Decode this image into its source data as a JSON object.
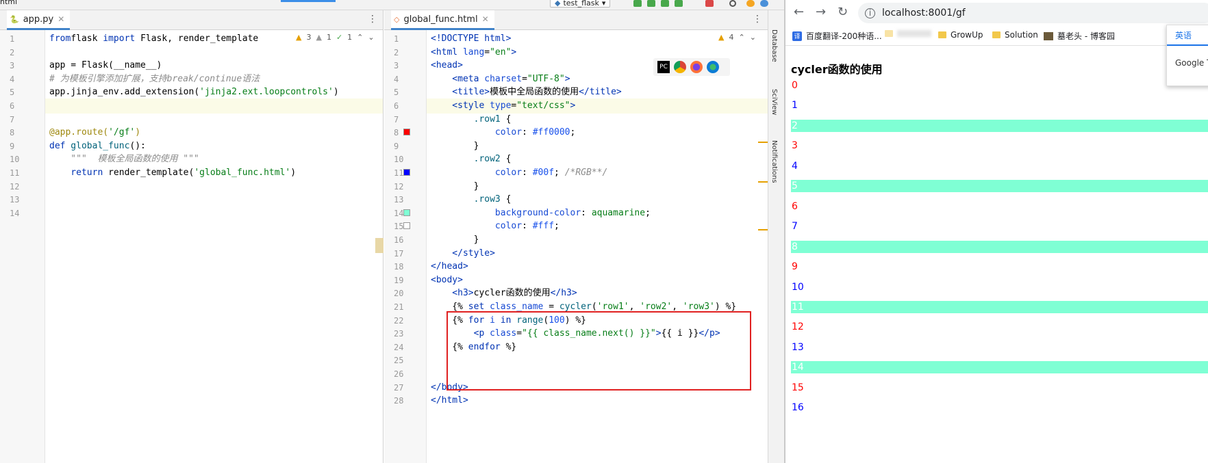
{
  "toolbar": {
    "crumb": "html",
    "run_config": "test_flask"
  },
  "left_editor": {
    "tab_label": "app.py",
    "inspection": {
      "warnings": "3",
      "weak_warnings": "1",
      "ok": "1"
    },
    "lines": [
      {
        "n": "1",
        "tokens": [
          [
            "kw",
            "from"
          ],
          [
            "",
            "flask "
          ],
          [
            "kw",
            "import"
          ],
          [
            "",
            " Flask, render_template"
          ]
        ]
      },
      {
        "n": "2",
        "tokens": []
      },
      {
        "n": "3",
        "tokens": [
          [
            "",
            "app = Flask(__name__)"
          ]
        ]
      },
      {
        "n": "4",
        "tokens": [
          [
            "cm",
            "# 为模板引擎添加扩展，支持break/continue语法"
          ]
        ]
      },
      {
        "n": "5",
        "tokens": [
          [
            "",
            "app.jinja_env.add_extension("
          ],
          [
            "str",
            "'jinja2.ext.loopcontrols'"
          ],
          [
            "",
            ")"
          ]
        ]
      },
      {
        "n": "6",
        "tokens": []
      },
      {
        "n": "7",
        "tokens": []
      },
      {
        "n": "8",
        "tokens": [
          [
            "dec",
            "@app.route("
          ],
          [
            "str",
            "'/gf'"
          ],
          [
            "dec",
            ")"
          ]
        ]
      },
      {
        "n": "9",
        "tokens": [
          [
            "kw",
            "def"
          ],
          [
            "fn",
            " global_func"
          ],
          [
            "",
            "():"
          ]
        ]
      },
      {
        "n": "10",
        "tokens": [
          [
            "cm",
            "    \"\"\"  模板全局函数的使用 \"\"\""
          ]
        ]
      },
      {
        "n": "11",
        "tokens": [
          [
            "kw",
            "    return"
          ],
          [
            "",
            " render_template("
          ],
          [
            "str",
            "'global_func.html'"
          ],
          [
            "",
            ")"
          ]
        ]
      },
      {
        "n": "12",
        "tokens": []
      },
      {
        "n": "13",
        "tokens": []
      },
      {
        "n": "14",
        "tokens": []
      }
    ]
  },
  "right_editor": {
    "tab_label": "global_func.html",
    "inspection": {
      "warnings": "4"
    },
    "lines": [
      {
        "n": "1",
        "tokens": [
          [
            "tag",
            "<!DOCTYPE html>"
          ]
        ]
      },
      {
        "n": "2",
        "tokens": [
          [
            "tag",
            "<html "
          ],
          [
            "attr",
            "lang"
          ],
          [
            "",
            "="
          ],
          [
            "str",
            "\"en\""
          ],
          [
            "tag",
            ">"
          ]
        ]
      },
      {
        "n": "3",
        "tokens": [
          [
            "tag",
            "<head>"
          ]
        ]
      },
      {
        "n": "4",
        "tokens": [
          [
            "tag",
            "    <meta "
          ],
          [
            "attr",
            "charset"
          ],
          [
            "",
            "="
          ],
          [
            "str",
            "\"UTF-8\""
          ],
          [
            "tag",
            ">"
          ]
        ]
      },
      {
        "n": "5",
        "tokens": [
          [
            "tag",
            "    <title>"
          ],
          [
            "",
            "模板中全局函数的使用"
          ],
          [
            "tag",
            "</title>"
          ]
        ]
      },
      {
        "n": "6",
        "tokens": [
          [
            "tag",
            "    <style "
          ],
          [
            "attr",
            "type"
          ],
          [
            "",
            "="
          ],
          [
            "str",
            "\"text/css\""
          ],
          [
            "tag",
            ">"
          ]
        ]
      },
      {
        "n": "7",
        "tokens": [
          [
            "fn",
            "        .row1"
          ],
          [
            "",
            " {"
          ]
        ]
      },
      {
        "n": "8",
        "tokens": [
          [
            "prop",
            "            color"
          ],
          [
            "",
            ": "
          ],
          [
            "num",
            "#ff0000"
          ],
          [
            "",
            ";"
          ]
        ]
      },
      {
        "n": "9",
        "tokens": [
          [
            "",
            "        }"
          ]
        ]
      },
      {
        "n": "10",
        "tokens": [
          [
            "fn",
            "        .row2"
          ],
          [
            "",
            " {"
          ]
        ]
      },
      {
        "n": "11",
        "tokens": [
          [
            "prop",
            "            color"
          ],
          [
            "",
            ": "
          ],
          [
            "num",
            "#00f"
          ],
          [
            "",
            "; "
          ],
          [
            "cm",
            "/*RGB**/"
          ]
        ]
      },
      {
        "n": "12",
        "tokens": [
          [
            "",
            "        }"
          ]
        ]
      },
      {
        "n": "13",
        "tokens": [
          [
            "fn",
            "        .row3"
          ],
          [
            "",
            " {"
          ]
        ]
      },
      {
        "n": "14",
        "tokens": [
          [
            "prop",
            "            background-color"
          ],
          [
            "",
            ": "
          ],
          [
            "str",
            "aquamarine"
          ],
          [
            "",
            ";"
          ]
        ]
      },
      {
        "n": "15",
        "tokens": [
          [
            "prop",
            "            color"
          ],
          [
            "",
            ": "
          ],
          [
            "num",
            "#fff"
          ],
          [
            "",
            ";"
          ]
        ]
      },
      {
        "n": "16",
        "tokens": [
          [
            "",
            "        }"
          ]
        ]
      },
      {
        "n": "17",
        "tokens": [
          [
            "tag",
            "    </style>"
          ]
        ]
      },
      {
        "n": "18",
        "tokens": [
          [
            "tag",
            "</head>"
          ]
        ]
      },
      {
        "n": "19",
        "tokens": [
          [
            "tag",
            "<body>"
          ]
        ]
      },
      {
        "n": "20",
        "tokens": [
          [
            "tag",
            "    <h3>"
          ],
          [
            "",
            "cycler函数的使用"
          ],
          [
            "tag",
            "</h3>"
          ]
        ]
      },
      {
        "n": "21",
        "tokens": [
          [
            "",
            "    {% "
          ],
          [
            "kw",
            "set"
          ],
          [
            "attr",
            " class_name"
          ],
          [
            "",
            " = "
          ],
          [
            "fn",
            "cycler"
          ],
          [
            "",
            "("
          ],
          [
            "str",
            "'row1'"
          ],
          [
            "",
            ", "
          ],
          [
            "str",
            "'row2'"
          ],
          [
            "",
            ", "
          ],
          [
            "str",
            "'row3'"
          ],
          [
            "",
            ") %}"
          ]
        ]
      },
      {
        "n": "22",
        "tokens": [
          [
            "",
            "    {% "
          ],
          [
            "kw",
            "for"
          ],
          [
            "attr",
            " i "
          ],
          [
            "kw",
            "in"
          ],
          [
            "fn",
            " range"
          ],
          [
            "",
            "("
          ],
          [
            "num",
            "100"
          ],
          [
            "",
            ") %}"
          ]
        ]
      },
      {
        "n": "23",
        "tokens": [
          [
            "tag",
            "        <p "
          ],
          [
            "attr",
            "class"
          ],
          [
            "",
            "="
          ],
          [
            "str",
            "\"{{ class_name.next() }}\""
          ],
          [
            "tag",
            ">"
          ],
          [
            "",
            "{{ i }}"
          ],
          [
            "tag",
            "</p>"
          ]
        ]
      },
      {
        "n": "24",
        "tokens": [
          [
            "",
            "    {% "
          ],
          [
            "kw",
            "endfor"
          ],
          [
            "",
            " %}"
          ]
        ]
      },
      {
        "n": "25",
        "tokens": []
      },
      {
        "n": "26",
        "tokens": []
      },
      {
        "n": "27",
        "tokens": [
          [
            "tag",
            "</body>"
          ]
        ]
      },
      {
        "n": "28",
        "tokens": [
          [
            "tag",
            "</html>"
          ]
        ]
      }
    ],
    "gutter_swatches": [
      {
        "line": "8",
        "color": "#ff0000"
      },
      {
        "line": "11",
        "color": "#0000ff"
      },
      {
        "line": "14",
        "color": "#7fffd4"
      },
      {
        "line": "15",
        "color": "#ffffff"
      }
    ]
  },
  "tool_windows": {
    "database": "Database",
    "sciview": "SciView",
    "notifications": "Notifications"
  },
  "browser": {
    "url": "localhost:8001/gf",
    "bookmarks": [
      {
        "label": "百度翻译-200种语...",
        "icon": "baidu-translate-icon"
      },
      {
        "label": "GrowUp",
        "icon": "folder-icon"
      },
      {
        "label": "Solution",
        "icon": "folder-icon"
      },
      {
        "label": "墓老头 - 博客园",
        "icon": "blog-icon"
      }
    ],
    "popup": {
      "tab": "英语",
      "item": "Google T"
    },
    "page_heading": "cycler函数的使用",
    "rows": [
      {
        "text": "0",
        "cls": "row1"
      },
      {
        "text": "1",
        "cls": "row2"
      },
      {
        "text": "2",
        "cls": "row3"
      },
      {
        "text": "3",
        "cls": "row1"
      },
      {
        "text": "4",
        "cls": "row2"
      },
      {
        "text": "5",
        "cls": "row3"
      },
      {
        "text": "6",
        "cls": "row1"
      },
      {
        "text": "7",
        "cls": "row2"
      },
      {
        "text": "8",
        "cls": "row3"
      },
      {
        "text": "9",
        "cls": "row1"
      },
      {
        "text": "10",
        "cls": "row2"
      },
      {
        "text": "11",
        "cls": "row3"
      },
      {
        "text": "12",
        "cls": "row1"
      },
      {
        "text": "13",
        "cls": "row2"
      },
      {
        "text": "14",
        "cls": "row3"
      },
      {
        "text": "15",
        "cls": "row1"
      },
      {
        "text": "16",
        "cls": "row2"
      }
    ]
  }
}
